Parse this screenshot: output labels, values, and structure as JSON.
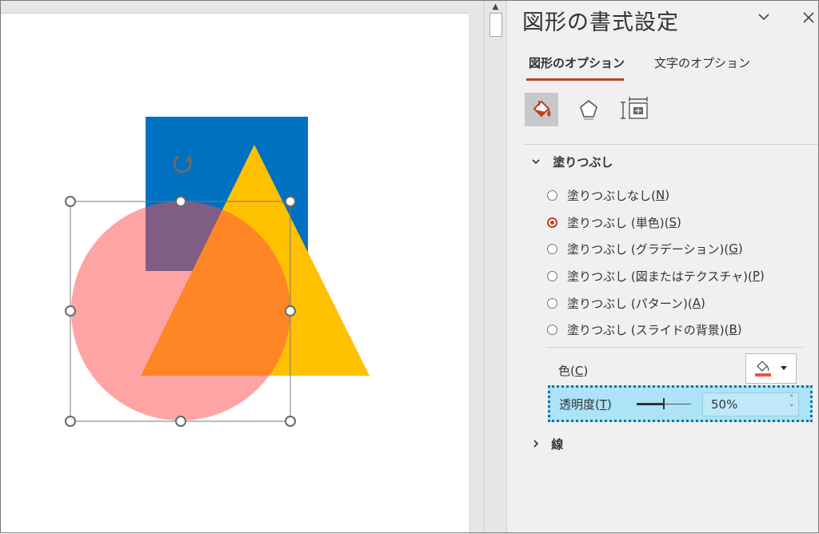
{
  "panel": {
    "title": "図形の書式設定",
    "tabs": [
      {
        "label": "図形のオプション",
        "active": true
      },
      {
        "label": "文字のオプション",
        "active": false
      }
    ],
    "icon_buttons": [
      "fill-and-line-icon",
      "effects-pentagon-icon",
      "size-and-properties-icon"
    ],
    "fill_section": {
      "title": "塗りつぶし",
      "options": [
        {
          "text": "塗りつぶしなし(",
          "key": "N",
          "end": ")",
          "checked": false
        },
        {
          "text": "塗りつぶし (単色)(",
          "key": "S",
          "end": ")",
          "checked": true
        },
        {
          "text": "塗りつぶし (グラデーション)(",
          "key": "G",
          "end": ")",
          "checked": false
        },
        {
          "text": "塗りつぶし (図またはテクスチャ)(",
          "key": "P",
          "end": ")",
          "checked": false
        },
        {
          "text": "塗りつぶし (パターン)(",
          "key": "A",
          "end": ")",
          "checked": false
        },
        {
          "text": "塗りつぶし (スライドの背景)(",
          "key": "B",
          "end": ")",
          "checked": false
        }
      ],
      "color_label": {
        "text": "色(",
        "key": "C",
        "end": ")"
      },
      "transparency_label": {
        "text": "透明度(",
        "key": "T",
        "end": ")"
      },
      "transparency_value": "50%",
      "transparency_fraction": 0.5
    },
    "line_section": {
      "title": "線"
    }
  },
  "colors": {
    "accent": "#c43e1c",
    "rectangle": "#0070c0",
    "triangle": "#ffc000",
    "circle": "#ff9f9f",
    "highlight_fill": "#ace3f6",
    "highlight_border": "#1c6ea4"
  }
}
